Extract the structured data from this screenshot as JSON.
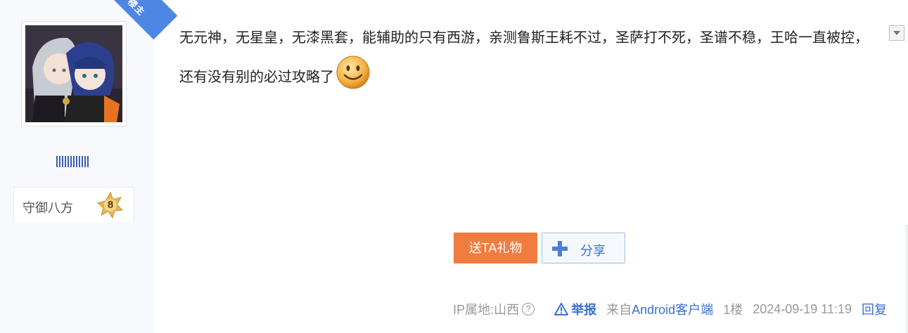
{
  "author": {
    "ribbon_label": "楼主",
    "badge_name": "守御八方",
    "badge_level": "8"
  },
  "post": {
    "text": "无元神，无星皇，无漆黑套，能辅助的只有西游，亲测鲁斯王耗不过，圣萨打不死，圣谱不稳，王哈一直被控，还有没有别的必过攻略了",
    "emoji_icon": "smiley-face-icon"
  },
  "actions": {
    "gift_label": "送TA礼物",
    "share_label": "分享"
  },
  "footer": {
    "ip_label": "IP属地:山西",
    "help_glyph": "?",
    "report_label": "举报",
    "client_prefix": "来自",
    "client_name": "Android客户端",
    "floor": "1楼",
    "timestamp": "2024-09-19 11:19",
    "reply_label": "回复"
  },
  "colors": {
    "accent_blue": "#3b6fd0",
    "gift_orange": "#f07c3f",
    "ribbon_blue": "#4d86e3"
  }
}
